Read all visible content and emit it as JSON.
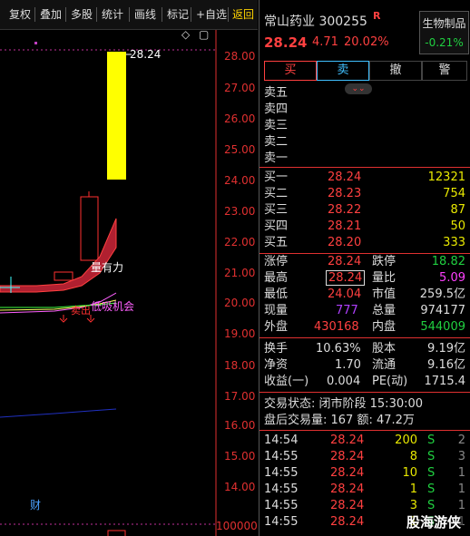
{
  "toolbar": {
    "items": [
      "复权",
      "叠加",
      "多股",
      "统计",
      "画线",
      "标记",
      "+自选",
      "返回"
    ]
  },
  "chart": {
    "price_axis": [
      "28.00",
      "27.00",
      "26.00",
      "25.00",
      "24.00",
      "23.00",
      "22.00",
      "21.00",
      "20.00",
      "19.00",
      "18.00",
      "17.00",
      "16.00",
      "15.00",
      "14.00"
    ],
    "volume_axis": "100000",
    "high_label": "28.24",
    "annotations": {
      "vol_power": "量有力",
      "sell_dot": "卖出",
      "buy_opportunity": "低吸机会",
      "fin_marker": "财"
    },
    "colors": {
      "up": "#ff3030",
      "yellow": "#ffff00",
      "grid": "#c0309a"
    }
  },
  "quote": {
    "name_code": "常山药业 300255",
    "flag": "R",
    "price": "28.24",
    "change": "4.71",
    "pct": "20.02%",
    "sector": "生物制品",
    "sector_pct": "-0.21%"
  },
  "actions": [
    "买",
    "卖",
    "撤",
    "警"
  ],
  "sell_levels": [
    "卖五",
    "卖四",
    "卖三",
    "卖二",
    "卖一"
  ],
  "buy_levels": [
    {
      "label": "买一",
      "price": "28.24",
      "vol": "12321"
    },
    {
      "label": "买二",
      "price": "28.23",
      "vol": "754"
    },
    {
      "label": "买三",
      "price": "28.22",
      "vol": "87"
    },
    {
      "label": "买四",
      "price": "28.21",
      "vol": "50"
    },
    {
      "label": "买五",
      "price": "28.20",
      "vol": "333"
    }
  ],
  "stats": [
    {
      "l1": "涨停",
      "v1": "28.24",
      "l2": "跌停",
      "v2": "18.82"
    },
    {
      "l1": "最高",
      "v1": "28.24",
      "l2": "量比",
      "v2": "5.09"
    },
    {
      "l1": "最低",
      "v1": "24.04",
      "l2": "市值",
      "v2": "259.5亿"
    },
    {
      "l1": "现量",
      "v1": "777",
      "l2": "总量",
      "v2": "974177"
    },
    {
      "l1": "外盘",
      "v1": "430168",
      "l2": "内盘",
      "v2": "544009"
    }
  ],
  "stats2": [
    {
      "l1": "换手",
      "v1": "10.63%",
      "l2": "股本",
      "v2": "9.19亿"
    },
    {
      "l1": "净资",
      "v1": "1.70",
      "l2": "流通",
      "v2": "9.16亿"
    },
    {
      "l1": "收益(一)",
      "v1": "0.004",
      "l2": "PE(动)",
      "v2": "1715.4"
    }
  ],
  "status": {
    "state": "交易状态: 闭市阶段 15:30:00",
    "after": "盘后交易量: 167  额: 47.2万"
  },
  "trades": [
    {
      "time": "14:54",
      "price": "28.24",
      "vol": "200",
      "side": "S",
      "n": "2"
    },
    {
      "time": "14:55",
      "price": "28.24",
      "vol": "8",
      "side": "S",
      "n": "3"
    },
    {
      "time": "14:55",
      "price": "28.24",
      "vol": "10",
      "side": "S",
      "n": "1"
    },
    {
      "time": "14:55",
      "price": "28.24",
      "vol": "1",
      "side": "S",
      "n": "1"
    },
    {
      "time": "14:55",
      "price": "28.24",
      "vol": "3",
      "side": "S",
      "n": "1"
    },
    {
      "time": "14:55",
      "price": "28.24",
      "vol": "1",
      "side": "S",
      "n": "1"
    }
  ],
  "watermark": "股海游侠"
}
